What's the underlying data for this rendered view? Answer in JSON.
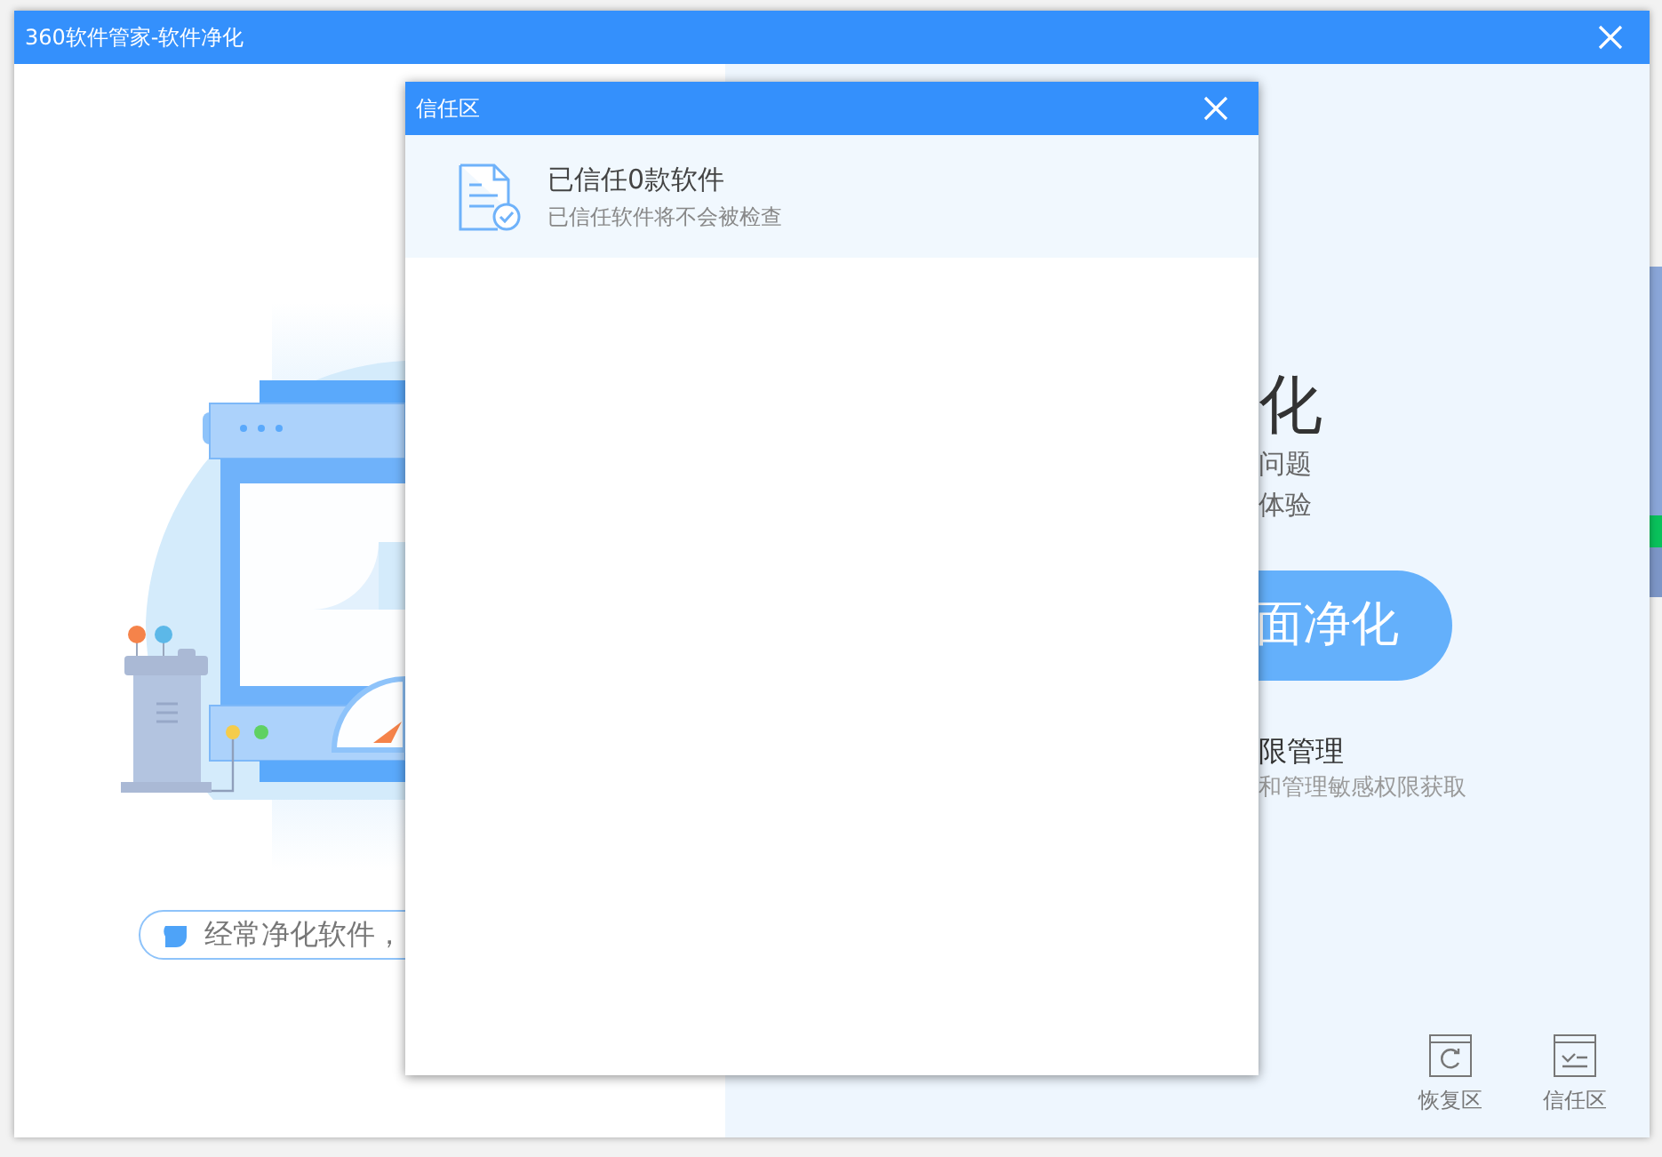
{
  "window": {
    "title": "360软件管家-软件净化"
  },
  "main": {
    "tip": "经常净化软件，",
    "heading": "化",
    "lines": [
      "问题",
      "体验"
    ],
    "clean_button": "面净化",
    "feature": {
      "title": "限管理",
      "description": "和管理敏感权限获取"
    },
    "tools": [
      {
        "kind": "restore",
        "label": "恢复区"
      },
      {
        "kind": "trust",
        "label": "信任区"
      }
    ]
  },
  "dialog": {
    "title": "信任区",
    "summary": {
      "title": "已信任0款软件",
      "description": "已信任软件将不会被检查"
    }
  }
}
